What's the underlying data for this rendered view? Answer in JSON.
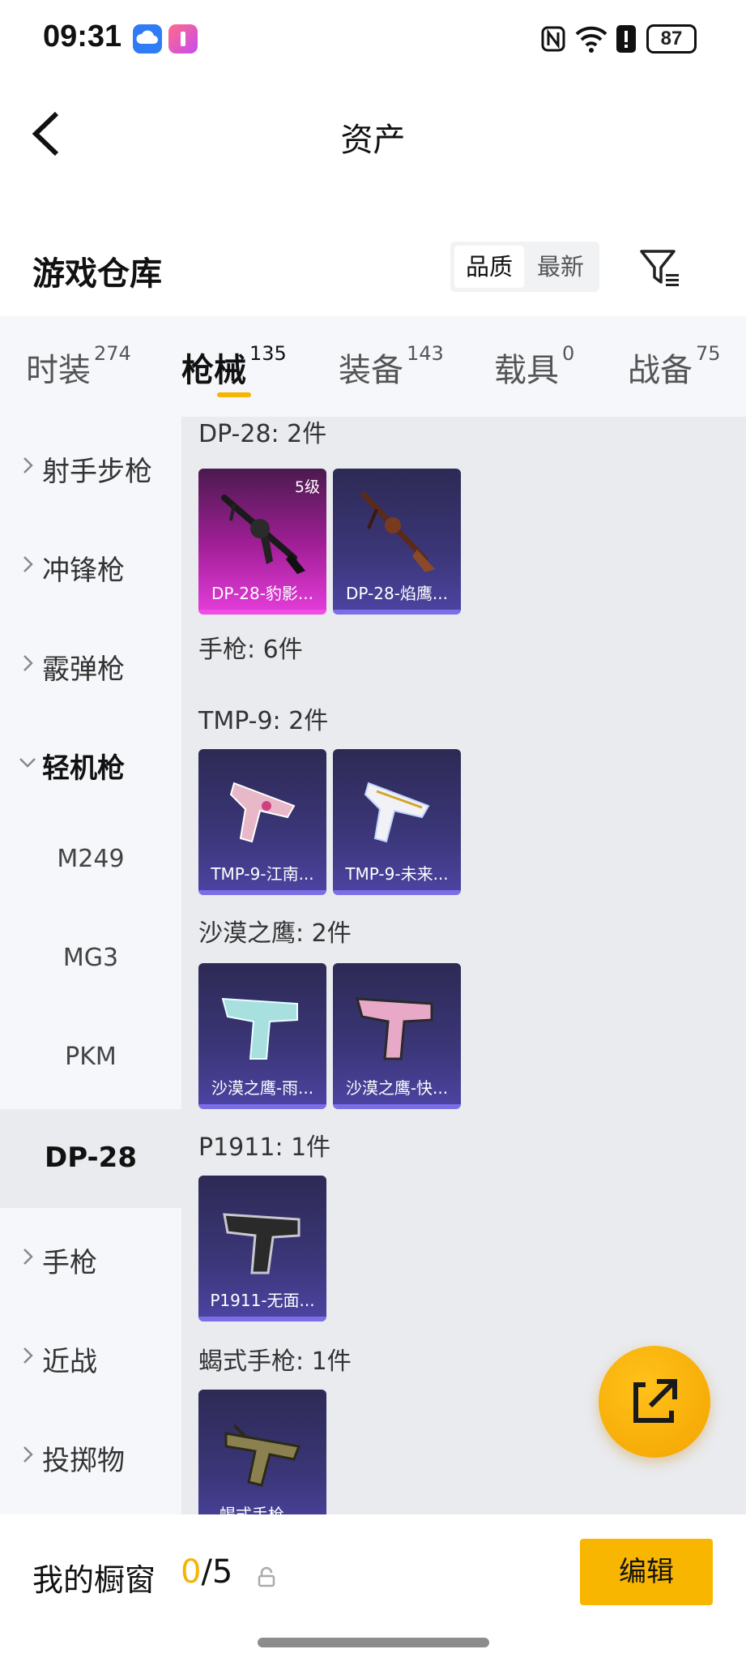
{
  "status_bar": {
    "time": "09:31",
    "battery": "87"
  },
  "header": {
    "title": "资产"
  },
  "warehouse": {
    "title": "游戏仓库",
    "sort_options": [
      "品质",
      "最新"
    ],
    "sort_selected": "品质"
  },
  "tabs": [
    {
      "label": "时装",
      "count": "274"
    },
    {
      "label": "枪械",
      "count": "135"
    },
    {
      "label": "装备",
      "count": "143"
    },
    {
      "label": "载具",
      "count": "0"
    },
    {
      "label": "战备",
      "count": "75"
    }
  ],
  "active_tab": "枪械",
  "sidebar": {
    "items": [
      {
        "label": "射手步枪"
      },
      {
        "label": "冲锋枪"
      },
      {
        "label": "霰弹枪"
      },
      {
        "label": "轻机枪"
      },
      {
        "label": "M249"
      },
      {
        "label": "MG3"
      },
      {
        "label": "PKM"
      },
      {
        "label": "DP-28"
      },
      {
        "label": "手枪"
      },
      {
        "label": "近战"
      },
      {
        "label": "投掷物"
      }
    ]
  },
  "groups": [
    {
      "title": "DP-28: 2件",
      "items": [
        {
          "name": "DP-28-豹影...",
          "level": "5级",
          "rarity": "pink"
        },
        {
          "name": "DP-28-焰鹰...",
          "rarity": "purple"
        }
      ]
    },
    {
      "title": "手枪: 6件",
      "items": []
    },
    {
      "title": "TMP-9: 2件",
      "items": [
        {
          "name": "TMP-9-江南...",
          "rarity": "purple"
        },
        {
          "name": "TMP-9-未来...",
          "rarity": "purple"
        }
      ]
    },
    {
      "title": "沙漠之鹰: 2件",
      "items": [
        {
          "name": "沙漠之鹰-雨...",
          "rarity": "purple"
        },
        {
          "name": "沙漠之鹰-快...",
          "rarity": "purple"
        }
      ]
    },
    {
      "title": "P1911: 1件",
      "items": [
        {
          "name": "P1911-无面...",
          "rarity": "purple"
        }
      ]
    },
    {
      "title": "蝎式手枪: 1件",
      "items": [
        {
          "name": "蝎式手枪-...",
          "rarity": "purple"
        }
      ]
    }
  ],
  "showcase": {
    "label": "我的橱窗",
    "current": "0",
    "total": "/5",
    "edit_label": "编辑"
  },
  "colors": {
    "accent": "#f5b400",
    "card_purple": "#3b3678",
    "card_pink": "#e23bd7"
  }
}
